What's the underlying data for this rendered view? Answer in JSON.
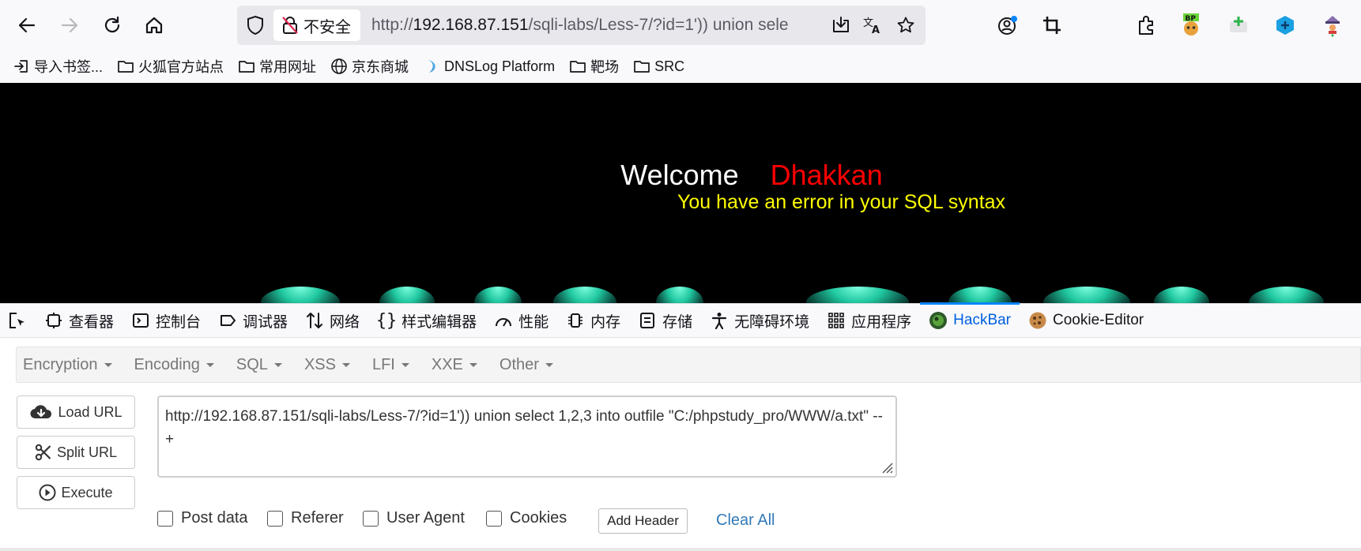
{
  "browser": {
    "url_insecure_label": "不安全",
    "url_prefix": "http://",
    "url_host": "192.168.87.151",
    "url_path": "/sqli-labs/Less-7/?id=1')) union sele"
  },
  "bookmarks": [
    {
      "label": "导入书签...",
      "icon": "import-icon"
    },
    {
      "label": "火狐官方站点",
      "icon": "folder-icon"
    },
    {
      "label": "常用网址",
      "icon": "folder-icon"
    },
    {
      "label": "京东商城",
      "icon": "globe-icon"
    },
    {
      "label": "DNSLog Platform",
      "icon": "dnslog-icon"
    },
    {
      "label": "靶场",
      "icon": "folder-icon"
    },
    {
      "label": "SRC",
      "icon": "folder-icon"
    }
  ],
  "page": {
    "welcome": "Welcome",
    "name": "Dhakkan",
    "error": "You have an error in your SQL syntax"
  },
  "devtools": {
    "tabs": [
      {
        "label": "查看器",
        "icon": "inspector-icon"
      },
      {
        "label": "控制台",
        "icon": "console-icon"
      },
      {
        "label": "调试器",
        "icon": "debugger-icon"
      },
      {
        "label": "网络",
        "icon": "network-icon"
      },
      {
        "label": "样式编辑器",
        "icon": "style-editor-icon"
      },
      {
        "label": "性能",
        "icon": "performance-icon"
      },
      {
        "label": "内存",
        "icon": "memory-icon"
      },
      {
        "label": "存储",
        "icon": "storage-icon"
      },
      {
        "label": "无障碍环境",
        "icon": "accessibility-icon"
      },
      {
        "label": "应用程序",
        "icon": "application-icon"
      },
      {
        "label": "HackBar",
        "icon": "hackbar-icon"
      },
      {
        "label": "Cookie-Editor",
        "icon": "cookie-icon"
      }
    ],
    "active_tab": "HackBar"
  },
  "hackbar": {
    "menus": [
      "Encryption",
      "Encoding",
      "SQL",
      "XSS",
      "LFI",
      "XXE",
      "Other"
    ],
    "load_url": "Load URL",
    "split_url": "Split URL",
    "execute": "Execute",
    "url_value": "http://192.168.87.151/sqli-labs/Less-7/?id=1')) union select 1,2,3 into outfile \"C:/phpstudy_pro/WWW/a.txt\" --+",
    "options": {
      "post_data": "Post data",
      "referer": "Referer",
      "user_agent": "User Agent",
      "cookies": "Cookies"
    },
    "add_header": "Add Header",
    "clear_all": "Clear All"
  },
  "colors": {
    "accent": "#0060df",
    "welcome": "#ffffff",
    "name": "#ff0000",
    "error": "#ffff00",
    "link": "#337ab7"
  }
}
